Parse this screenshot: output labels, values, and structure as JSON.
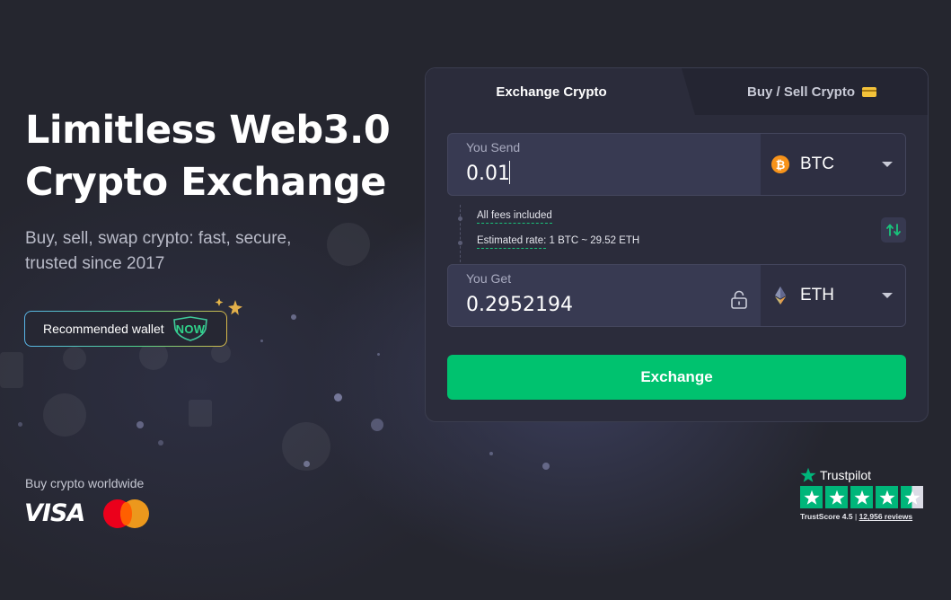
{
  "hero": {
    "title_line1": "Limitless Web3.0",
    "title_line2": "Crypto Exchange",
    "subtitle_line1": "Buy, sell, swap crypto: fast, secure,",
    "subtitle_line2": "trusted since 2017",
    "wallet_button_label": "Recommended wallet",
    "wallet_brand": "NOW"
  },
  "payments": {
    "label": "Buy crypto worldwide",
    "visa": "VISA",
    "mastercard_icon": "mastercard-icon"
  },
  "widget": {
    "tabs": [
      {
        "label": "Exchange Crypto",
        "active": true
      },
      {
        "label": "Buy / Sell Crypto",
        "active": false,
        "icon": "credit-card-icon"
      }
    ],
    "send": {
      "label": "You Send",
      "value": "0.01",
      "currency": "BTC",
      "icon": "bitcoin-icon"
    },
    "fees_label": "All fees included",
    "rate_label": "Estimated rate:",
    "rate_value": "1 BTC ~ 29.52 ETH",
    "get": {
      "label": "You Get",
      "value": "0.2952194",
      "currency": "ETH",
      "icon": "ethereum-icon"
    },
    "exchange_button": "Exchange",
    "swap_icon": "swap-arrows-icon",
    "lock_icon": "unlock-icon"
  },
  "trustpilot": {
    "brand": "Trustpilot",
    "score_label": "TrustScore 4.5",
    "separator": "|",
    "reviews": "12,956 reviews",
    "rating": 4.5
  },
  "colors": {
    "background": "#25262f",
    "card": "#2b2c3b",
    "accent_green": "#00c26f",
    "trustpilot_green": "#00b67a",
    "bitcoin_orange": "#f7931a"
  }
}
